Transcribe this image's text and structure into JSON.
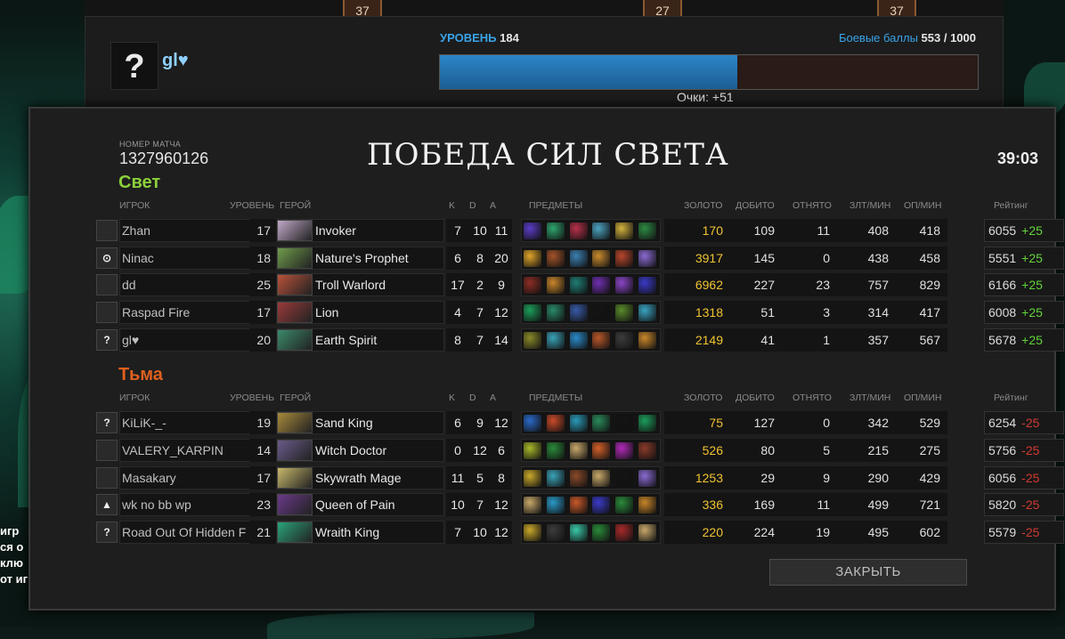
{
  "profile": {
    "avatar_glyph": "?",
    "name": "gl♥",
    "level_label": "УРОВЕНЬ",
    "level_value": "184",
    "battle_label": "Боевые баллы",
    "battle_value": "553 / 1000",
    "battle_progress": 0.553,
    "points_text": "Очки: +51",
    "top_levels": [
      "37",
      "27",
      "37"
    ]
  },
  "match": {
    "id_label": "НОМЕР МАТЧА",
    "id": "1327960126",
    "title": "ПОБЕДА СИЛ СВЕТА",
    "duration": "39:03"
  },
  "columns": {
    "player": "ИГРОК",
    "level": "УРОВЕНЬ",
    "hero": "ГЕРОЙ",
    "k": "K",
    "d": "D",
    "a": "A",
    "items": "ПРЕДМЕТЫ",
    "gold": "ЗОЛОТО",
    "lasthits": "ДОБИТО",
    "denies": "ОТНЯТО",
    "gpm": "ЗЛТ/МИН",
    "xpm": "ОП/МИН",
    "rating": "Рейтинг"
  },
  "teams": [
    {
      "name": "Свет",
      "color": "#8bd13b",
      "players": [
        {
          "name": "Zhan",
          "level": "17",
          "hero": "Invoker",
          "k": "7",
          "d": "10",
          "a": "11",
          "gold": "170",
          "lh": "109",
          "dn": "11",
          "gpm": "408",
          "xpm": "418",
          "rating": "6055",
          "change": "+25",
          "icon": "",
          "icon_name": "avatar-icon",
          "hero_color": "#c1a9c9",
          "items": [
            "#5b3dc8",
            "#2fa56f",
            "#b8314a",
            "#4ca4c2",
            "#d2b23c",
            "#2d8a44"
          ]
        },
        {
          "name": "Ninac",
          "level": "18",
          "hero": "Nature's Prophet",
          "k": "6",
          "d": "8",
          "a": "20",
          "gold": "3917",
          "lh": "145",
          "dn": "0",
          "gpm": "438",
          "xpm": "458",
          "rating": "5551",
          "change": "+25",
          "icon": "⊙",
          "icon_name": "target-icon",
          "hero_color": "#6f9c4b",
          "items": [
            "#e0a32a",
            "#a4532a",
            "#3c7fb0",
            "#c98b2e",
            "#b8462d",
            "#8a6ad2"
          ]
        },
        {
          "name": "dd",
          "level": "25",
          "hero": "Troll Warlord",
          "k": "17",
          "d": "2",
          "a": "9",
          "gold": "6962",
          "lh": "227",
          "dn": "23",
          "gpm": "757",
          "xpm": "829",
          "rating": "6166",
          "change": "+25",
          "icon": "",
          "icon_name": "avatar-icon",
          "hero_color": "#b9523a",
          "items": [
            "#8c2d25",
            "#c8862a",
            "#1f7d74",
            "#6f2fb0",
            "#8a45c7",
            "#3a3ac8"
          ]
        },
        {
          "name": "Raspad Fire",
          "level": "17",
          "hero": "Lion",
          "k": "4",
          "d": "7",
          "a": "12",
          "gold": "1318",
          "lh": "51",
          "dn": "3",
          "gpm": "314",
          "xpm": "417",
          "rating": "6008",
          "change": "+25",
          "icon": "",
          "icon_name": "avatar-icon",
          "hero_color": "#9a3a3a",
          "items": [
            "#1c9d5a",
            "#2a8a6a",
            "#375aa6",
            "#141414",
            "#5a8a2a",
            "#3aa3c2"
          ]
        },
        {
          "name": "gl♥",
          "level": "20",
          "hero": "Earth Spirit",
          "k": "8",
          "d": "7",
          "a": "14",
          "gold": "2149",
          "lh": "41",
          "dn": "1",
          "gpm": "357",
          "xpm": "567",
          "rating": "5678",
          "change": "+25",
          "icon": "?",
          "icon_name": "unknown-avatar-icon",
          "hero_color": "#3a8a6a",
          "items": [
            "#8a8a2a",
            "#3aa3b8",
            "#2a8ac8",
            "#b8582a",
            "#3c3c3c",
            "#c9862a"
          ]
        }
      ]
    },
    {
      "name": "Тьма",
      "color": "#e0601e",
      "players": [
        {
          "name": "KiLiK-_-",
          "level": "19",
          "hero": "Sand King",
          "k": "6",
          "d": "9",
          "a": "12",
          "gold": "75",
          "lh": "127",
          "dn": "0",
          "gpm": "342",
          "xpm": "529",
          "rating": "6254",
          "change": "-25",
          "icon": "?",
          "icon_name": "unknown-avatar-icon",
          "hero_color": "#a88a3a",
          "items": [
            "#2a6ac8",
            "#c84a2a",
            "#2a9ab8",
            "#2a8a5a",
            "#141414",
            "#1c9d5a"
          ]
        },
        {
          "name": "VALERY_KARPIN",
          "level": "14",
          "hero": "Witch Doctor",
          "k": "0",
          "d": "12",
          "a": "6",
          "gold": "526",
          "lh": "80",
          "dn": "5",
          "gpm": "215",
          "xpm": "275",
          "rating": "5756",
          "change": "-25",
          "icon": "",
          "icon_name": "avatar-icon",
          "hero_color": "#6a5a8a",
          "items": [
            "#a8b82a",
            "#2a8a3a",
            "#c8a86a",
            "#d2602a",
            "#b02ab8",
            "#8a3a2a"
          ]
        },
        {
          "name": "Masakary",
          "level": "17",
          "hero": "Skywrath Mage",
          "k": "11",
          "d": "5",
          "a": "8",
          "gold": "1253",
          "lh": "29",
          "dn": "9",
          "gpm": "290",
          "xpm": "429",
          "rating": "6056",
          "change": "-25",
          "icon": "",
          "icon_name": "avatar-icon",
          "hero_color": "#c8b86a",
          "items": [
            "#c8a82a",
            "#3aa3b8",
            "#8a4a2a",
            "#c8a86a",
            "#141414",
            "#8a6ad2"
          ]
        },
        {
          "name": "wk no bb wp",
          "level": "23",
          "hero": "Queen of Pain",
          "k": "10",
          "d": "7",
          "a": "12",
          "gold": "336",
          "lh": "169",
          "dn": "11",
          "gpm": "499",
          "xpm": "721",
          "rating": "5820",
          "change": "-25",
          "icon": "▲",
          "icon_name": "warning-icon",
          "hero_color": "#6a3a8a",
          "items": [
            "#c8a86a",
            "#2a9ac8",
            "#c8582a",
            "#3a3ac8",
            "#2a8a3a",
            "#c9862a"
          ]
        },
        {
          "name": "Road Out Of Hidden F",
          "level": "21",
          "hero": "Wraith King",
          "k": "7",
          "d": "10",
          "a": "12",
          "gold": "220",
          "lh": "224",
          "dn": "19",
          "gpm": "495",
          "xpm": "602",
          "rating": "5579",
          "change": "-25",
          "icon": "?",
          "icon_name": "unknown-avatar-icon",
          "hero_color": "#2aa37a",
          "items": [
            "#c8a82a",
            "#3c3c3c",
            "#3ac8a8",
            "#2a8a3a",
            "#a82a2a",
            "#c8a86a"
          ]
        }
      ]
    }
  ],
  "close_button": "ЗАКРЫТЬ",
  "chat_fragment": [
    "игр",
    "ся о",
    "клю",
    "от иг"
  ]
}
